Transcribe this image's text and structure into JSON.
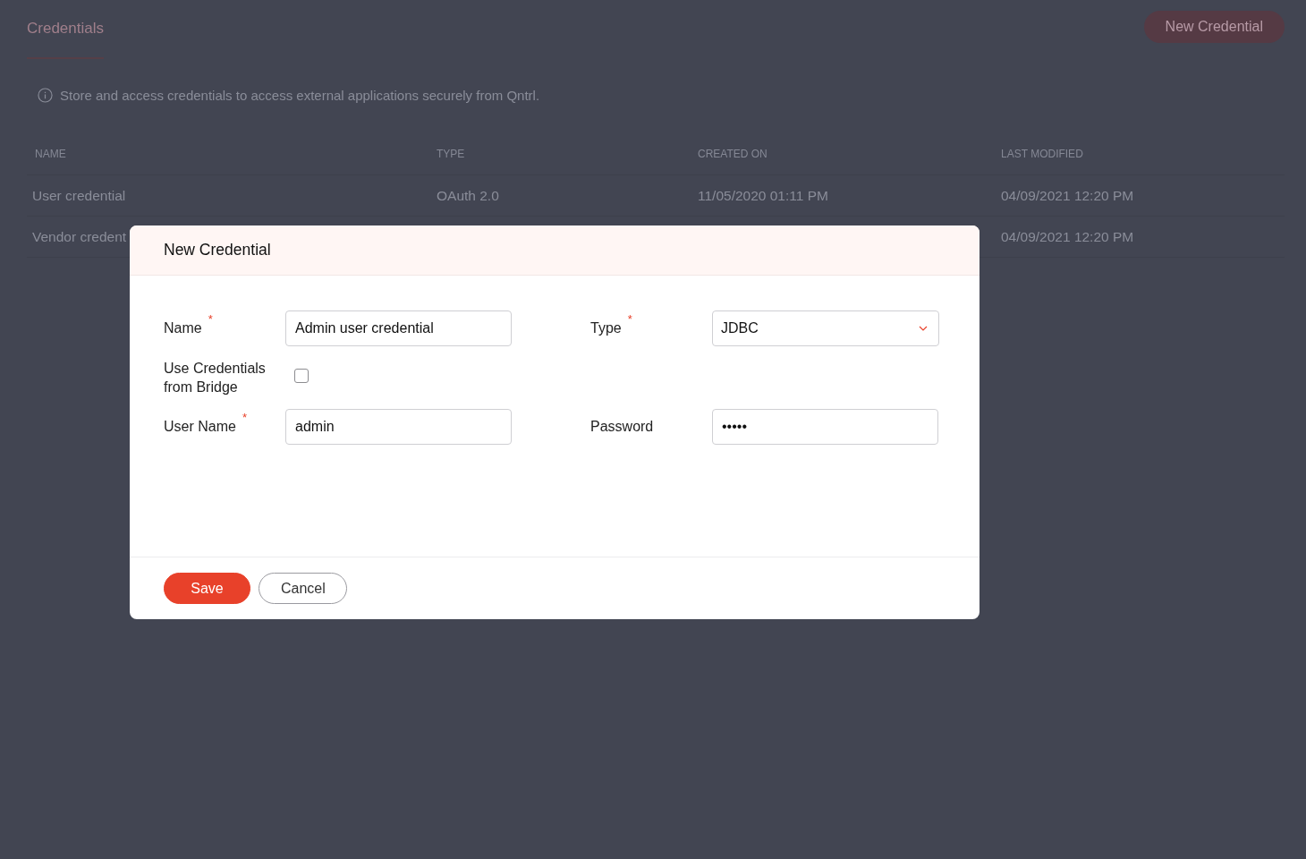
{
  "page": {
    "title": "Credentials",
    "new_button": "New Credential",
    "info": "Store and access credentials to access external applications securely from Qntrl."
  },
  "table": {
    "columns": [
      "NAME",
      "TYPE",
      "CREATED ON",
      "LAST MODIFIED"
    ],
    "rows": [
      {
        "cells": [
          "User credential",
          "OAuth 2.0",
          "11/05/2020 01:11 PM",
          "04/09/2021 12:20 PM"
        ]
      },
      {
        "cells": [
          "Vendor credent",
          null,
          null,
          "04/09/2021 12:20 PM"
        ]
      }
    ]
  },
  "dialog": {
    "title": "New Credential",
    "fields": [
      {
        "kind": "text",
        "label": "Name",
        "required_mark": "*",
        "value": "Admin user credential"
      },
      {
        "kind": "select",
        "label": "Type",
        "required_mark": "*",
        "value": "JDBC"
      },
      {
        "kind": "checkbox",
        "label": "Use Credentials from Bridge",
        "checked": false
      },
      {
        "kind": "text",
        "label": "User Name",
        "required_mark": "*",
        "value": "admin"
      },
      {
        "kind": "password",
        "label": "Password",
        "value": "•••••"
      }
    ],
    "buttons": [
      {
        "kind": "primary",
        "label": "Save"
      },
      {
        "kind": "secondary",
        "label": "Cancel"
      }
    ]
  }
}
